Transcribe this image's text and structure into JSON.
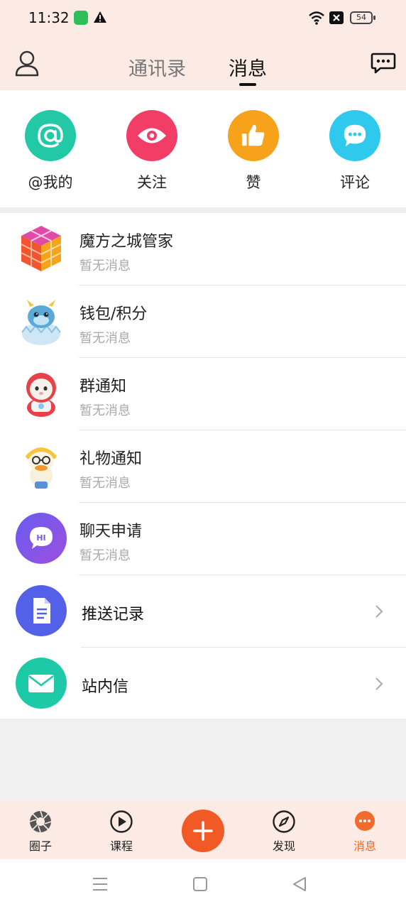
{
  "status_bar": {
    "time": "11:32",
    "battery": "54"
  },
  "header": {
    "tabs": [
      {
        "label": "通讯录",
        "active": false
      },
      {
        "label": "消息",
        "active": true
      }
    ]
  },
  "quick_actions": [
    {
      "label": "@我的",
      "icon": "at-icon",
      "color": "#23c9a6"
    },
    {
      "label": "关注",
      "icon": "eye-icon",
      "color": "#f23d67"
    },
    {
      "label": "赞",
      "icon": "thumbs-up-icon",
      "color": "#f7a21b"
    },
    {
      "label": "评论",
      "icon": "comment-icon",
      "color": "#2fc9ee"
    }
  ],
  "messages": [
    {
      "title": "魔方之城管家",
      "subtitle": "暂无消息",
      "icon": "cube-logo"
    },
    {
      "title": "钱包/积分",
      "subtitle": "暂无消息",
      "icon": "dragon-mascot"
    },
    {
      "title": "群通知",
      "subtitle": "暂无消息",
      "icon": "astronaut-mascot"
    },
    {
      "title": "礼物通知",
      "subtitle": "暂无消息",
      "icon": "duck-mascot"
    },
    {
      "title": "聊天申请",
      "subtitle": "暂无消息",
      "icon": "hi-bubble-icon"
    }
  ],
  "links": [
    {
      "title": "推送记录",
      "icon": "document-icon",
      "color": "#5261e8"
    },
    {
      "title": "站内信",
      "icon": "mail-icon",
      "color": "#1ec9a8"
    }
  ],
  "bottom_nav": [
    {
      "label": "圈子",
      "icon": "aperture-icon",
      "active": false
    },
    {
      "label": "课程",
      "icon": "play-icon",
      "active": false
    },
    {
      "label": "发现",
      "icon": "compass-icon",
      "active": false
    },
    {
      "label": "消息",
      "icon": "message-dots-icon",
      "active": true
    }
  ],
  "colors": {
    "accent": "#f26a2e",
    "header_bg": "#fbebe4"
  }
}
